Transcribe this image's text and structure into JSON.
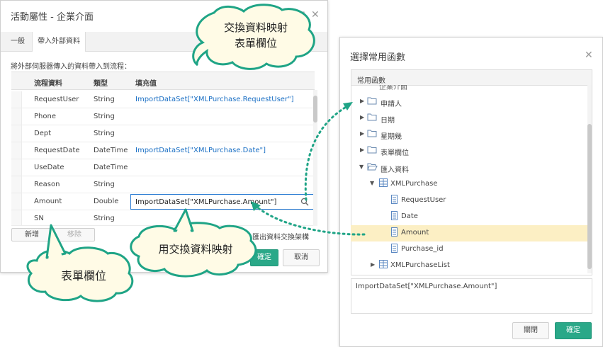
{
  "left_dialog": {
    "title": "活動屬性 - 企業介面",
    "tabs": [
      {
        "label": "一般"
      },
      {
        "label": "帶入外部資料"
      }
    ],
    "description": "將外部伺服器傳入的資料帶入到流程：",
    "columns": [
      "流程資料",
      "類型",
      "填充值"
    ],
    "rows": [
      {
        "name": "RequestUser",
        "type": "String",
        "value": "ImportDataSet[\"XMLPurchase.RequestUser\"]"
      },
      {
        "name": "Phone",
        "type": "String",
        "value": ""
      },
      {
        "name": "Dept",
        "type": "String",
        "value": ""
      },
      {
        "name": "RequestDate",
        "type": "DateTime",
        "value": "ImportDataSet[\"XMLPurchase.Date\"]"
      },
      {
        "name": "UseDate",
        "type": "DateTime",
        "value": ""
      },
      {
        "name": "Reason",
        "type": "String",
        "value": ""
      },
      {
        "name": "Amount",
        "type": "Double",
        "value": "ImportDataSet[\"XMLPurchase.Amount\"]"
      },
      {
        "name": "SN",
        "type": "String",
        "value": ""
      }
    ],
    "add_label": "新增",
    "remove_label": "移除",
    "export_label": "匯出資料交換架構",
    "ok_label": "確定",
    "cancel_label": "取消"
  },
  "right_dialog": {
    "title": "選擇常用函數",
    "header": "常用函數",
    "partial_label": "企業介面",
    "tree": [
      {
        "label": "申請人",
        "icon": "folder-icon"
      },
      {
        "label": "日期",
        "icon": "folder-icon"
      },
      {
        "label": "星期幾",
        "icon": "folder-icon"
      },
      {
        "label": "表單欄位",
        "icon": "folder-icon"
      },
      {
        "label": "匯入資料",
        "icon": "folder-open-icon"
      },
      {
        "label": "XMLPurchase",
        "icon": "table-icon"
      },
      {
        "label": "RequestUser",
        "icon": "field-icon"
      },
      {
        "label": "Date",
        "icon": "field-icon"
      },
      {
        "label": "Amount",
        "icon": "field-icon"
      },
      {
        "label": "Purchase_id",
        "icon": "field-icon"
      },
      {
        "label": "XMLPurchaseList",
        "icon": "table-icon"
      }
    ],
    "expression": "ImportDataSet[\"XMLPurchase.Amount\"]",
    "close_label": "關閉",
    "ok_label": "確定"
  },
  "callouts": {
    "top_line1": "交換資料映射",
    "top_line2": "表單欄位",
    "middle": "用交換資料映射",
    "bottom": "表單欄位"
  },
  "colors": {
    "accent": "#2aa888",
    "link": "#1a6fc4",
    "selected_row": "#fcefc4",
    "bubble_border": "#1fa486",
    "bubble_fill": "#fffbe6"
  }
}
